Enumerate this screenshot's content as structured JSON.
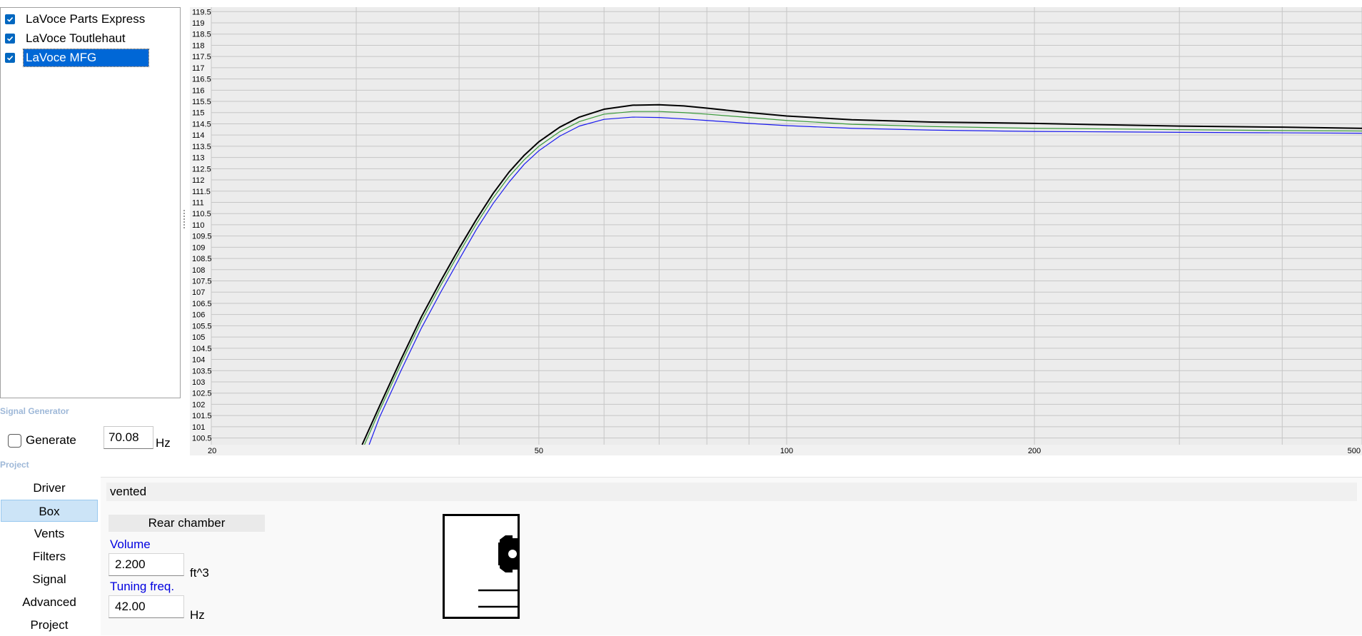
{
  "projects": [
    {
      "label": "LaVoce Parts Express",
      "checked": true,
      "selected": false
    },
    {
      "label": "LaVoce Toutlehaut",
      "checked": true,
      "selected": false
    },
    {
      "label": "LaVoce MFG",
      "checked": true,
      "selected": true
    }
  ],
  "signal_generator": {
    "header": "Signal Generator",
    "generate_label": "Generate",
    "generate_checked": false,
    "frequency": "70.08",
    "unit": "Hz"
  },
  "project_section": {
    "header": "Project"
  },
  "nav": {
    "items": [
      "Driver",
      "Box",
      "Vents",
      "Filters",
      "Signal",
      "Advanced",
      "Project"
    ],
    "active": "Box"
  },
  "box": {
    "type": "vented",
    "rear_chamber_label": "Rear chamber",
    "volume_label": "Volume",
    "volume_value": "2.200",
    "volume_unit": "ft^3",
    "tuning_label": "Tuning freq.",
    "tuning_value": "42.00",
    "tuning_unit": "Hz"
  },
  "chart_data": {
    "type": "line",
    "x_scale": "log",
    "xlim": [
      20,
      500
    ],
    "ylim": [
      100.2,
      119.7
    ],
    "grid": true,
    "x_ticks": [
      20,
      50,
      100,
      200,
      500
    ],
    "y_ticks": [
      100.5,
      101,
      101.5,
      102,
      102.5,
      103,
      103.5,
      104,
      104.5,
      105,
      105.5,
      106,
      106.5,
      107,
      107.5,
      108,
      108.5,
      109,
      109.5,
      110,
      110.5,
      111,
      111.5,
      112,
      112.5,
      113,
      113.5,
      114,
      114.5,
      115,
      115.5,
      116,
      116.5,
      117,
      117.5,
      118,
      118.5,
      119,
      119.5
    ],
    "series": [
      {
        "color": "#000000",
        "width": 2,
        "x": [
          30.5,
          32,
          34,
          36,
          38,
          40,
          42,
          44,
          46,
          48,
          50,
          53,
          56,
          60,
          65,
          70,
          75,
          80,
          90,
          100,
          120,
          150,
          200,
          250,
          300,
          400,
          500
        ],
        "y": [
          100.2,
          101.9,
          104.0,
          105.9,
          107.5,
          108.95,
          110.25,
          111.4,
          112.35,
          113.1,
          113.7,
          114.35,
          114.8,
          115.15,
          115.33,
          115.35,
          115.3,
          115.2,
          115.0,
          114.85,
          114.68,
          114.58,
          114.52,
          114.45,
          114.4,
          114.35,
          114.3
        ]
      },
      {
        "color": "#3a9a3a",
        "width": 1.2,
        "x": [
          30.7,
          32,
          34,
          36,
          38,
          40,
          42,
          44,
          46,
          48,
          50,
          53,
          56,
          60,
          65,
          70,
          75,
          80,
          90,
          100,
          120,
          150,
          200,
          250,
          300,
          400,
          500
        ],
        "y": [
          100.2,
          101.7,
          103.8,
          105.7,
          107.3,
          108.75,
          110.05,
          111.2,
          112.15,
          112.9,
          113.5,
          114.15,
          114.6,
          114.93,
          115.05,
          115.05,
          115.0,
          114.93,
          114.78,
          114.65,
          114.48,
          114.38,
          114.3,
          114.27,
          114.24,
          114.2,
          114.18
        ]
      },
      {
        "color": "#1a1aee",
        "width": 1.2,
        "x": [
          31.1,
          32,
          34,
          36,
          38,
          40,
          42,
          44,
          46,
          48,
          50,
          53,
          56,
          60,
          65,
          70,
          75,
          80,
          90,
          100,
          120,
          150,
          200,
          250,
          300,
          400,
          500
        ],
        "y": [
          100.2,
          101.4,
          103.5,
          105.4,
          107.0,
          108.45,
          109.8,
          110.95,
          111.9,
          112.7,
          113.3,
          113.95,
          114.4,
          114.7,
          114.8,
          114.78,
          114.72,
          114.65,
          114.52,
          114.42,
          114.3,
          114.22,
          114.16,
          114.14,
          114.12,
          114.1,
          114.08
        ]
      }
    ]
  },
  "icons": {
    "checkbox": "checkmark-icon",
    "diagram": "vented-box-diagram-icon"
  }
}
